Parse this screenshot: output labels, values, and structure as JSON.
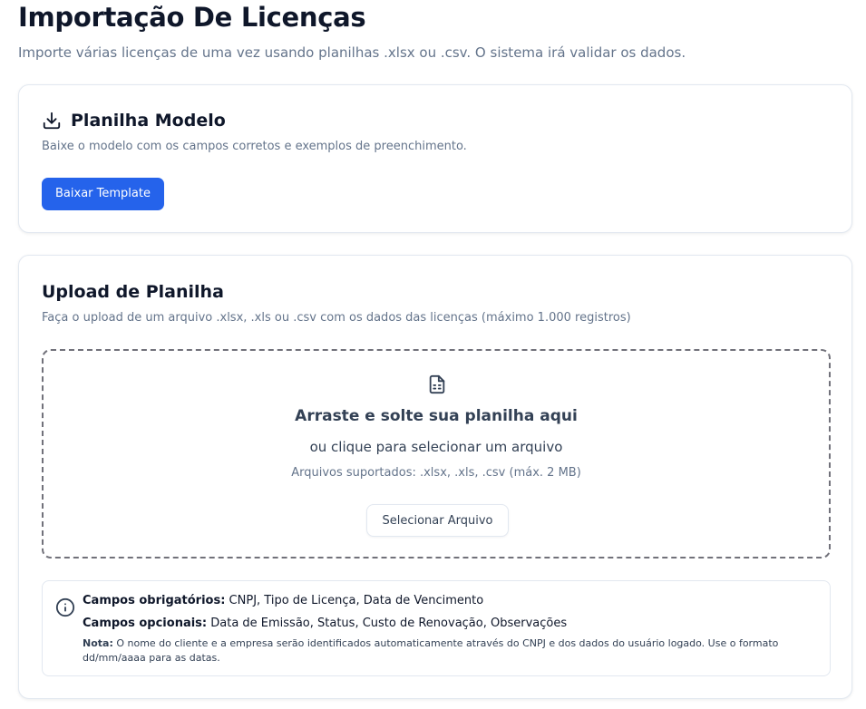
{
  "page": {
    "title": "Importação De Licenças",
    "subtitle": "Importe várias licenças de uma vez usando planilhas .xlsx ou .csv. O sistema irá validar os dados."
  },
  "template_card": {
    "icon": "download-icon",
    "title": "Planilha Modelo",
    "description": "Baixe o modelo com os campos corretos e exemplos de preenchimento.",
    "button_label": "Baixar Template"
  },
  "upload_card": {
    "title": "Upload de Planilha",
    "description": "Faça o upload de um arquivo .xlsx, .xls ou .csv com os dados das licenças (máximo 1.000 registros)",
    "dropzone": {
      "icon": "file-spreadsheet-icon",
      "title": "Arraste e solte sua planilha aqui",
      "subtitle": "ou clique para selecionar um arquivo",
      "hint": "Arquivos suportados: .xlsx, .xls, .csv (máx. 2 MB)",
      "button_label": "Selecionar Arquivo"
    },
    "info": {
      "icon": "info-icon",
      "required_label": "Campos obrigatórios:",
      "required_value": " CNPJ, Tipo de Licença, Data de Vencimento",
      "optional_label": "Campos opcionais:",
      "optional_value": " Data de Emissão, Status, Custo de Renovação, Observações",
      "note_label": "Nota:",
      "note_value": " O nome do cliente e a empresa serão identificados automaticamente através do CNPJ e dos dados do usuário logado. Use o formato dd/mm/aaaa para as datas."
    }
  },
  "colors": {
    "primary": "#2563eb",
    "text": "#0f172a",
    "muted": "#64748b",
    "border": "#e2e8f0"
  }
}
